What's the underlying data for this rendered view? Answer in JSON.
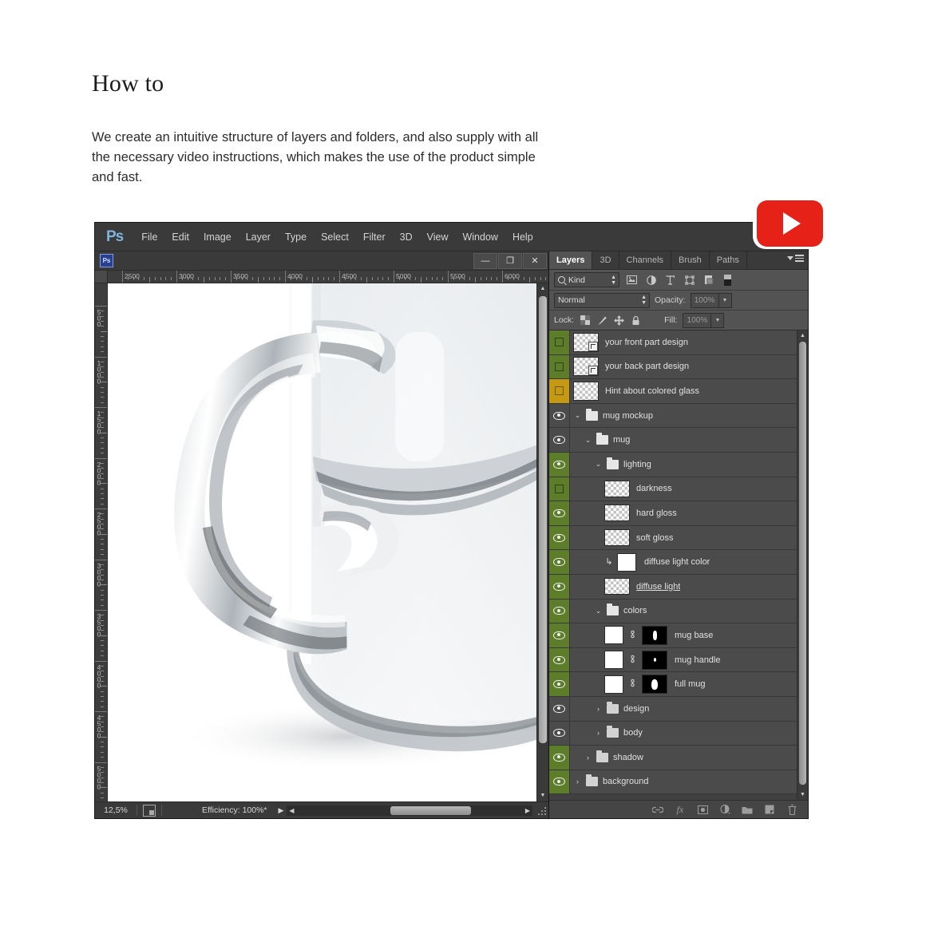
{
  "intro": {
    "heading": "How to",
    "paragraph": "We create an intuitive structure of layers and folders, and also supply with all the necessary video instructions, which makes the use of the product simple and fast."
  },
  "app": {
    "logo": "Ps",
    "tab_badge": "Ps",
    "menu": [
      "File",
      "Edit",
      "Image",
      "Layer",
      "Type",
      "Select",
      "Filter",
      "3D",
      "View",
      "Window",
      "Help"
    ],
    "window_buttons": {
      "minimize": "—",
      "maximize": "❐",
      "close": "✕"
    }
  },
  "rulers": {
    "horizontal_labels": [
      "2500",
      "3000",
      "3500",
      "4000",
      "4500",
      "5000",
      "5500",
      "6000"
    ],
    "vertical_labels": [
      "500",
      "1000",
      "1500",
      "2000",
      "2500",
      "3000",
      "3500",
      "4000",
      "4500",
      "5000"
    ],
    "unit_step": 500
  },
  "status": {
    "zoom": "12,5%",
    "efficiency": "Efficiency: 100%*",
    "arrow": "▶"
  },
  "panel": {
    "tabs": [
      {
        "label": "Layers",
        "active": true
      },
      {
        "label": "3D",
        "active": false
      },
      {
        "label": "Channels",
        "active": false
      },
      {
        "label": "Brush",
        "active": false
      },
      {
        "label": "Paths",
        "active": false
      }
    ],
    "filter": {
      "kind_label": "Kind",
      "stepper": "↕",
      "icons": [
        "pixel-filter-icon",
        "adjustment-filter-icon",
        "type-filter-icon",
        "shape-filter-icon",
        "smart-object-filter-icon",
        "filter-toggle-icon"
      ]
    },
    "blend": {
      "mode": "Normal",
      "opacity_label": "Opacity:",
      "opacity_value": "100%"
    },
    "lock": {
      "label": "Lock:",
      "fill_label": "Fill:",
      "fill_value": "100%",
      "icons": [
        "lock-transparent-pixels-icon",
        "lock-image-pixels-icon",
        "lock-position-icon",
        "lock-all-icon"
      ]
    },
    "footer_icons": [
      "link-layers-icon",
      "layer-style-fx-icon",
      "add-layer-mask-icon",
      "adjustment-layer-icon",
      "new-group-icon",
      "new-layer-icon",
      "delete-layer-icon"
    ],
    "layers": [
      {
        "name": "your front part design",
        "indent": 0,
        "type": "smart-object",
        "visible": false,
        "swatch": "green"
      },
      {
        "name": "your back part design",
        "indent": 0,
        "type": "smart-object",
        "visible": false,
        "swatch": "green"
      },
      {
        "name": "Hint about colored glass",
        "indent": 0,
        "type": "pixel",
        "visible": false,
        "swatch": "olive"
      },
      {
        "name": "mug mockup",
        "indent": 0,
        "type": "group",
        "open": true,
        "visible": true,
        "swatch": "none"
      },
      {
        "name": "mug",
        "indent": 1,
        "type": "group",
        "open": true,
        "visible": true,
        "swatch": "none"
      },
      {
        "name": "lighting",
        "indent": 2,
        "type": "group",
        "open": true,
        "visible": true,
        "swatch": "green"
      },
      {
        "name": "darkness",
        "indent": 3,
        "type": "pixel",
        "visible": false,
        "swatch": "green"
      },
      {
        "name": "hard gloss",
        "indent": 3,
        "type": "pixel",
        "visible": true,
        "swatch": "green"
      },
      {
        "name": "soft gloss",
        "indent": 3,
        "type": "pixel",
        "visible": true,
        "swatch": "green"
      },
      {
        "name": "diffuse light color",
        "indent": 3,
        "type": "solid-clipped",
        "visible": true,
        "swatch": "green"
      },
      {
        "name": "diffuse light ",
        "indent": 3,
        "type": "pixel",
        "visible": true,
        "swatch": "green",
        "editing": true
      },
      {
        "name": "colors",
        "indent": 2,
        "type": "group",
        "open": true,
        "visible": true,
        "swatch": "green"
      },
      {
        "name": "mug base",
        "indent": 3,
        "type": "masked",
        "visible": true,
        "swatch": "green"
      },
      {
        "name": "mug handle",
        "indent": 3,
        "type": "masked",
        "visible": true,
        "swatch": "green"
      },
      {
        "name": "full mug",
        "indent": 3,
        "type": "masked",
        "visible": true,
        "swatch": "green"
      },
      {
        "name": "design",
        "indent": 2,
        "type": "group",
        "open": false,
        "visible": true,
        "swatch": "none"
      },
      {
        "name": "body",
        "indent": 2,
        "type": "group",
        "open": false,
        "visible": true,
        "swatch": "none"
      },
      {
        "name": "shadow",
        "indent": 1,
        "type": "group",
        "open": false,
        "visible": true,
        "swatch": "green"
      },
      {
        "name": "background",
        "indent": 0,
        "type": "group",
        "open": false,
        "visible": true,
        "swatch": "green"
      }
    ]
  },
  "video_badge": {
    "name": "youtube-play-badge",
    "color": "#e62117"
  },
  "colors": {
    "chrome": "#3a3a3a",
    "panel": "#454545",
    "row": "#4b4b4b",
    "swatch_green": "#5d7d2b",
    "swatch_olive": "#c59a12",
    "accent_blue": "#7fb5dd"
  }
}
